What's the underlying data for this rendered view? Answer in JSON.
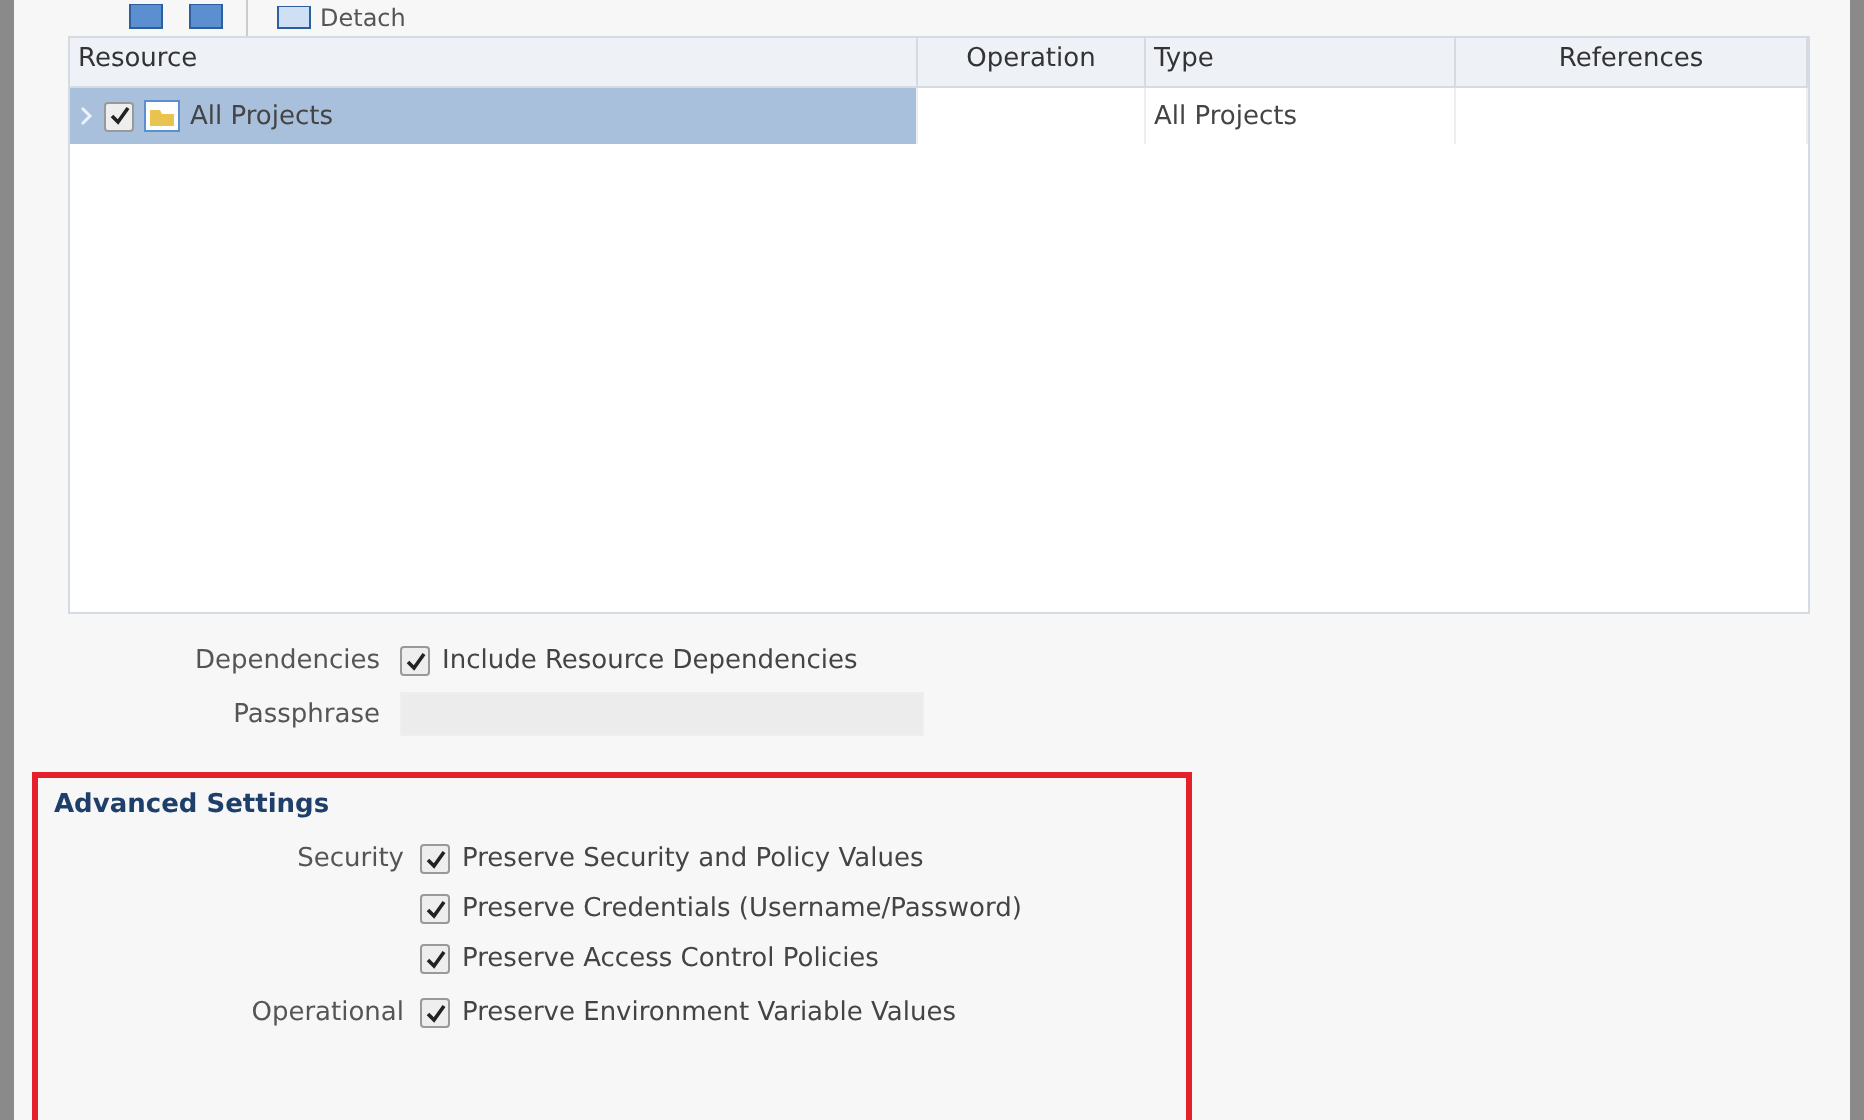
{
  "toolbar": {
    "buttons": [
      {
        "kind": "icon"
      },
      {
        "kind": "icon"
      },
      {
        "kind": "text",
        "label": "Detach"
      }
    ]
  },
  "table": {
    "columns": [
      "Resource",
      "Operation",
      "Type",
      "References"
    ],
    "rows": [
      {
        "selected": true,
        "expanded": false,
        "checked": true,
        "resource": "All Projects",
        "type": "All Projects"
      }
    ]
  },
  "dependencies": {
    "label": "Dependencies",
    "checked": true,
    "option": "Include Resource Dependencies"
  },
  "passphrase": {
    "label": "Passphrase"
  },
  "advanced_settings": {
    "title": "Advanced Settings",
    "groups": [
      {
        "label": "Security",
        "options": [
          {
            "label": "Preserve Security and Policy Values",
            "checked": true
          },
          {
            "label": "Preserve Credentials (Username/Password)",
            "checked": true
          },
          {
            "label": "Preserve Access Control Policies",
            "checked": true
          }
        ]
      },
      {
        "label": "Operational",
        "options": [
          {
            "label": "Preserve Environment Variable Values",
            "checked": true
          }
        ]
      }
    ]
  }
}
